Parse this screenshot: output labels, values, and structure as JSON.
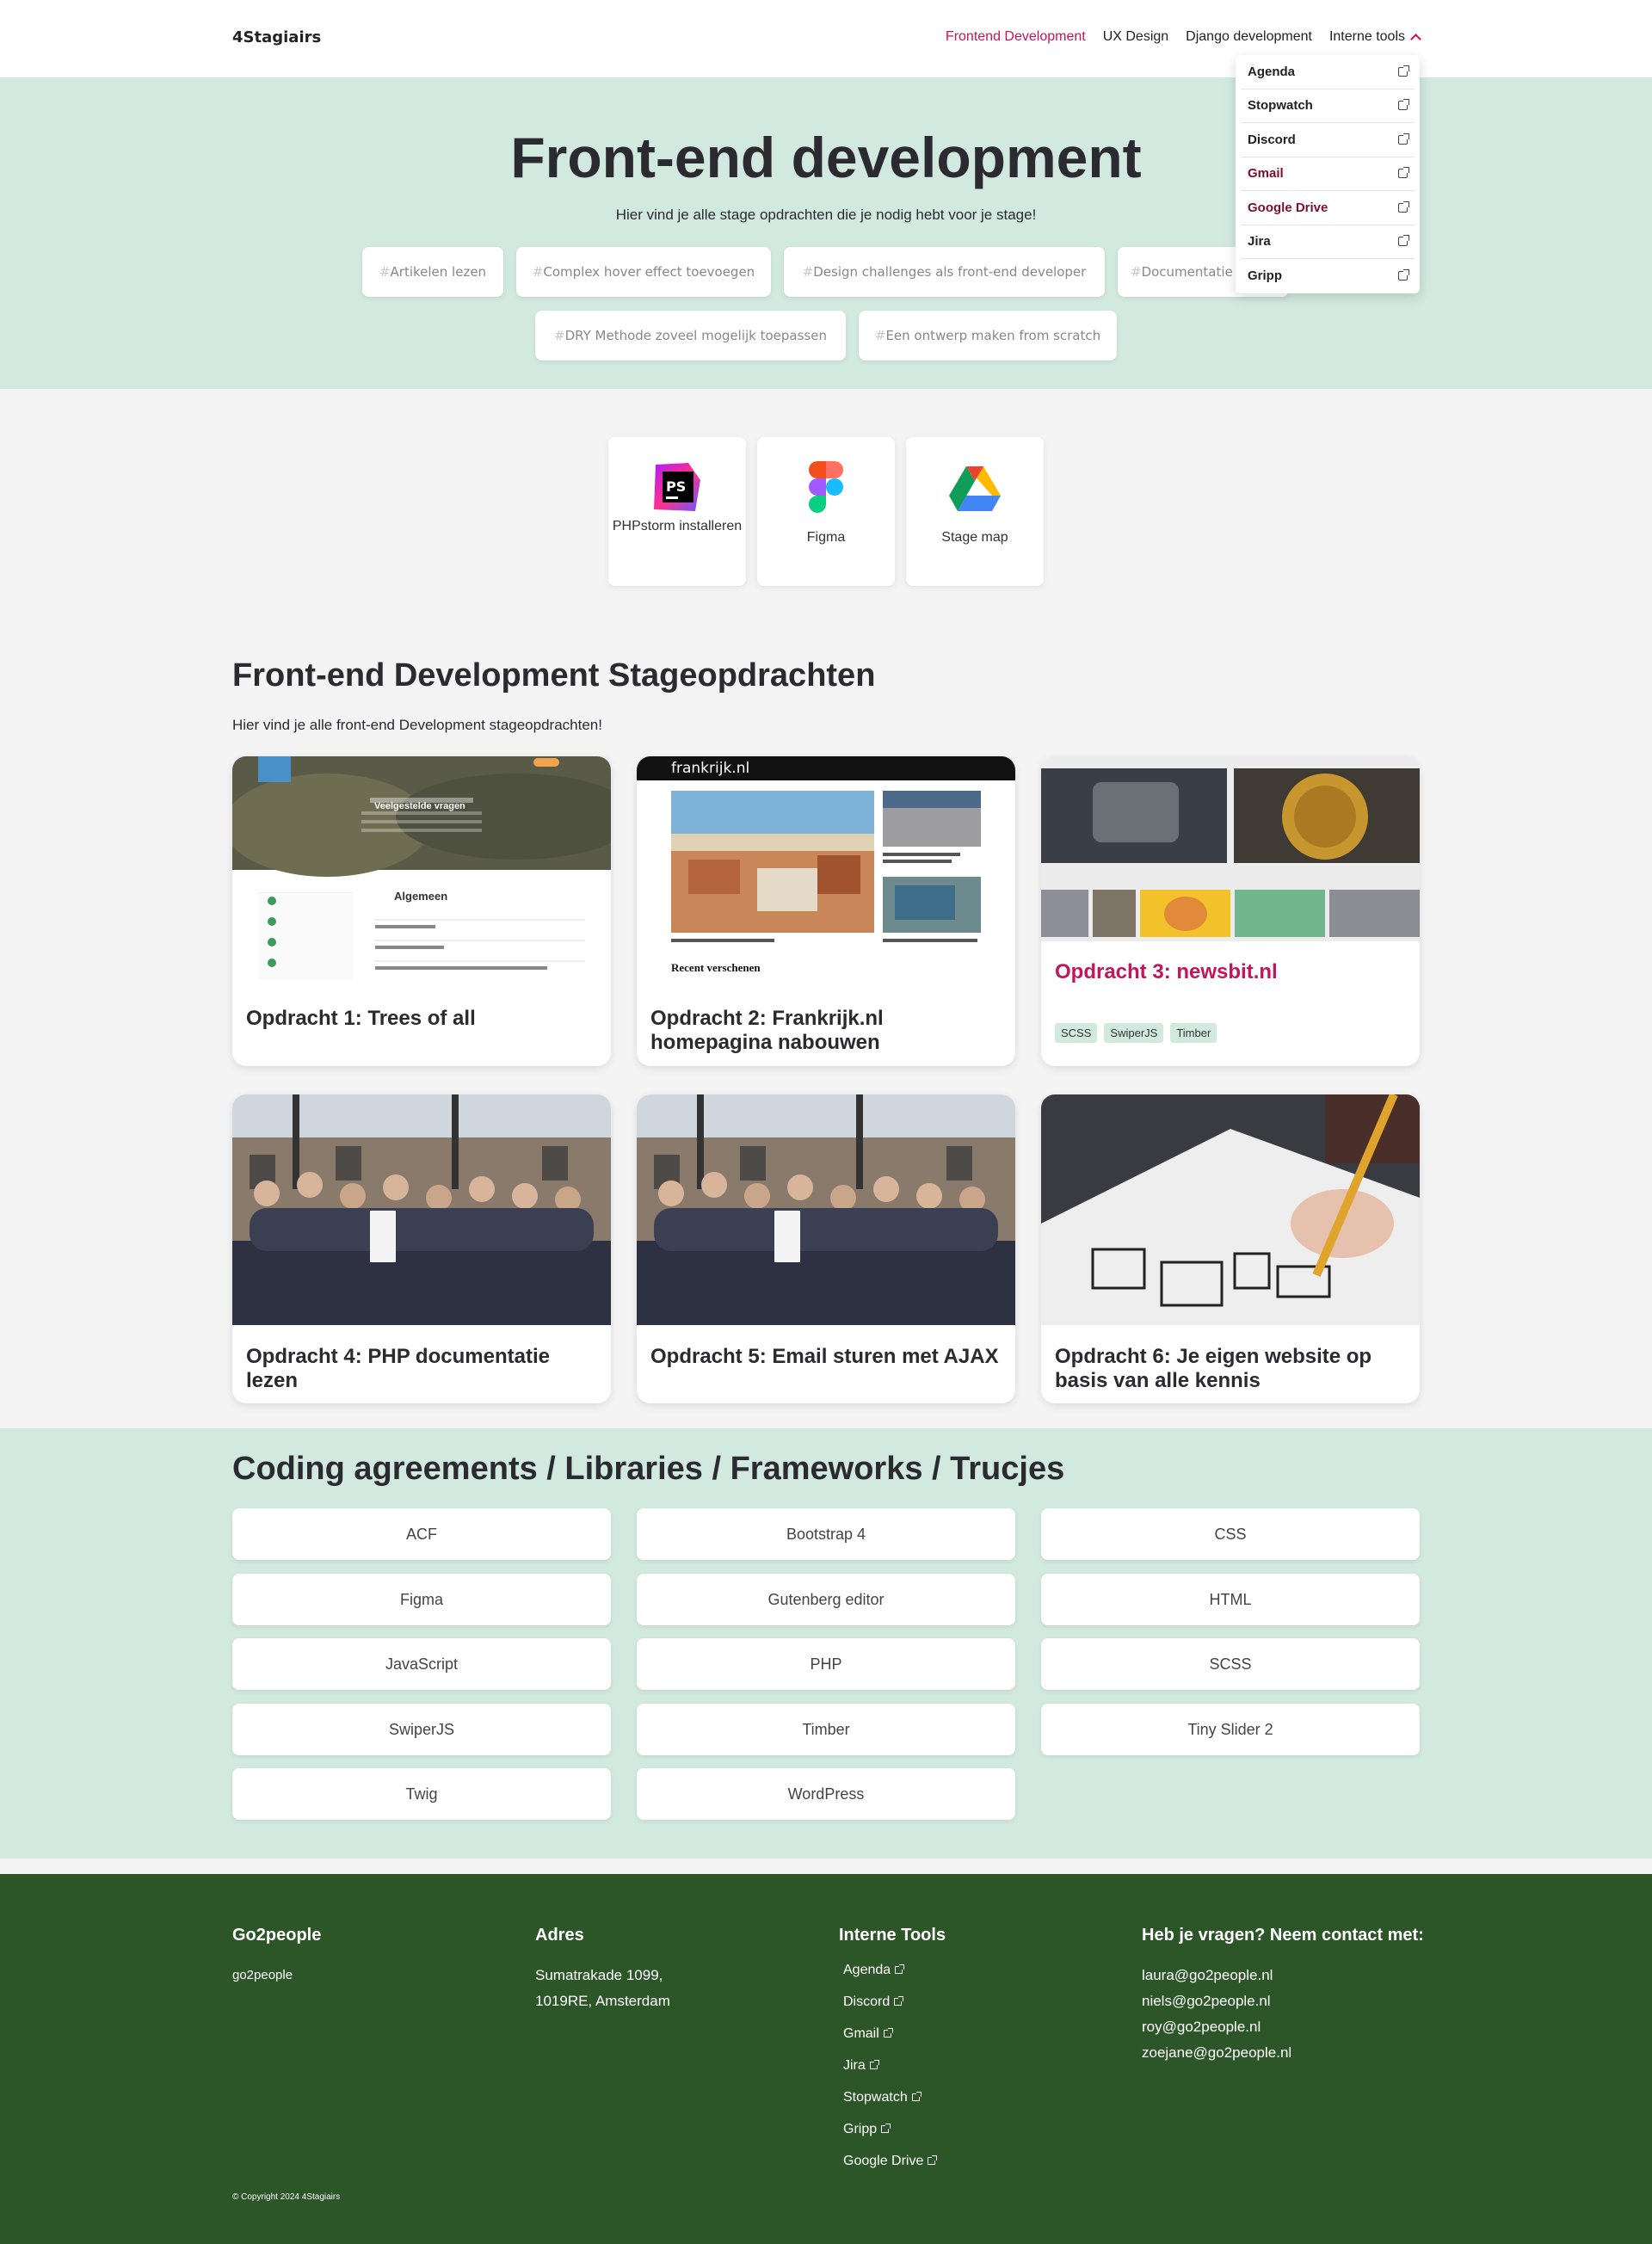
{
  "header": {
    "logo": "4Stagiairs",
    "nav": [
      "Frontend Development",
      "UX Design",
      "Django development",
      "Interne tools"
    ]
  },
  "dropdown": [
    "Agenda",
    "Stopwatch",
    "Discord",
    "Gmail",
    "Google Drive",
    "Jira",
    "Gripp"
  ],
  "hero": {
    "title": "Front-end development",
    "subtitle": "Hier vind je alle stage opdrachten die je nodig hebt voor je stage!",
    "tags": [
      "Artikelen lezen",
      "Complex hover effect toevoegen",
      "Design challenges als front-end developer",
      "Documentatie",
      "DRY Methode zoveel mogelijk toepassen",
      "Een ontwerp maken from scratch"
    ]
  },
  "tools": [
    {
      "label": "PHPstorm installeren",
      "icon": "phpstorm-icon"
    },
    {
      "label": "Figma",
      "icon": "figma-icon"
    },
    {
      "label": "Stage map",
      "icon": "google-drive-icon"
    }
  ],
  "assignments": {
    "title": "Front-end Development Stageopdrachten",
    "subtitle": "Hier vind je alle front-end Development stageopdrachten!",
    "cards": [
      {
        "title": "Opdracht 1: Trees of all"
      },
      {
        "title": "Opdracht 2: Frankrijk.nl homepagina nabouwen"
      },
      {
        "title": "Opdracht 3: newsbit.nl",
        "badges": [
          "SCSS",
          "SwiperJS",
          "Timber"
        ]
      },
      {
        "title": "Opdracht 4: PHP documentatie lezen"
      },
      {
        "title": "Opdracht 5: Email sturen met AJAX"
      },
      {
        "title": "Opdracht 6: Je eigen website op basis van alle kennis"
      }
    ],
    "preview": {
      "c1_heading": "Veelgestelde vragen",
      "c1_side": "Algemeen",
      "c2_brand": "frankrijk.nl",
      "c2_section": "Recent verschenen"
    }
  },
  "agreements": {
    "title": "Coding agreements / Libraries / Frameworks / Trucjes",
    "items": [
      "ACF",
      "Bootstrap 4",
      "CSS",
      "Figma",
      "Gutenberg editor",
      "HTML",
      "JavaScript",
      "PHP",
      "SCSS",
      "SwiperJS",
      "Timber",
      "Tiny Slider 2",
      "Twig",
      "WordPress"
    ]
  },
  "footer": {
    "col1_title": "Go2people",
    "col1_text": "go2people",
    "col2_title": "Adres",
    "address": [
      "Sumatrakade 1099,",
      "1019RE, Amsterdam"
    ],
    "col3_title": "Interne Tools",
    "tools": [
      "Agenda",
      "Discord",
      "Gmail",
      "Jira",
      "Stopwatch",
      "Gripp",
      "Google Drive"
    ],
    "col4_title": "Heb je vragen? Neem contact met:",
    "contacts": [
      "laura@go2people.nl",
      "niels@go2people.nl",
      "roy@go2people.nl",
      "zoejane@go2people.nl"
    ],
    "copyright": "© Copyright 2024 4Stagiairs"
  },
  "colors": {
    "accent": "#c4145a",
    "mint": "#d2e9e0",
    "footer": "#2c5528"
  }
}
